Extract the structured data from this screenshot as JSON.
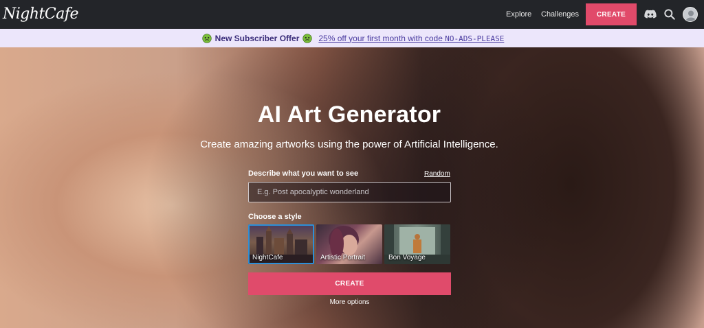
{
  "header": {
    "logo": "NightCafe",
    "nav": {
      "explore": "Explore",
      "challenges": "Challenges",
      "create": "CREATE"
    },
    "icons": [
      "discord-icon",
      "search-icon",
      "avatar-icon"
    ]
  },
  "promo": {
    "emoji": "zombie-face-icon",
    "title": "New Subscriber Offer",
    "link_text": "25% off your first month with code ",
    "code": "NO-ADS-PLEASE"
  },
  "hero": {
    "title": "AI Art Generator",
    "subtitle": "Create amazing artworks using the power of Artificial Intelligence.",
    "describe_label": "Describe what you want to see",
    "random_link": "Random",
    "prompt_placeholder": "E.g. Post apocalyptic wonderland",
    "prompt_value": "",
    "style_label": "Choose a style",
    "styles": [
      {
        "label": "NightCafe",
        "selected": true
      },
      {
        "label": "Artistic Portrait",
        "selected": false
      },
      {
        "label": "Bon Voyage",
        "selected": false
      }
    ],
    "create_button": "CREATE",
    "more_options": "More options"
  },
  "colors": {
    "accent": "#e04b6b",
    "nav_bg": "#232529",
    "promo_bg": "#ece6fb",
    "selected_outline": "#2d8fd8"
  }
}
